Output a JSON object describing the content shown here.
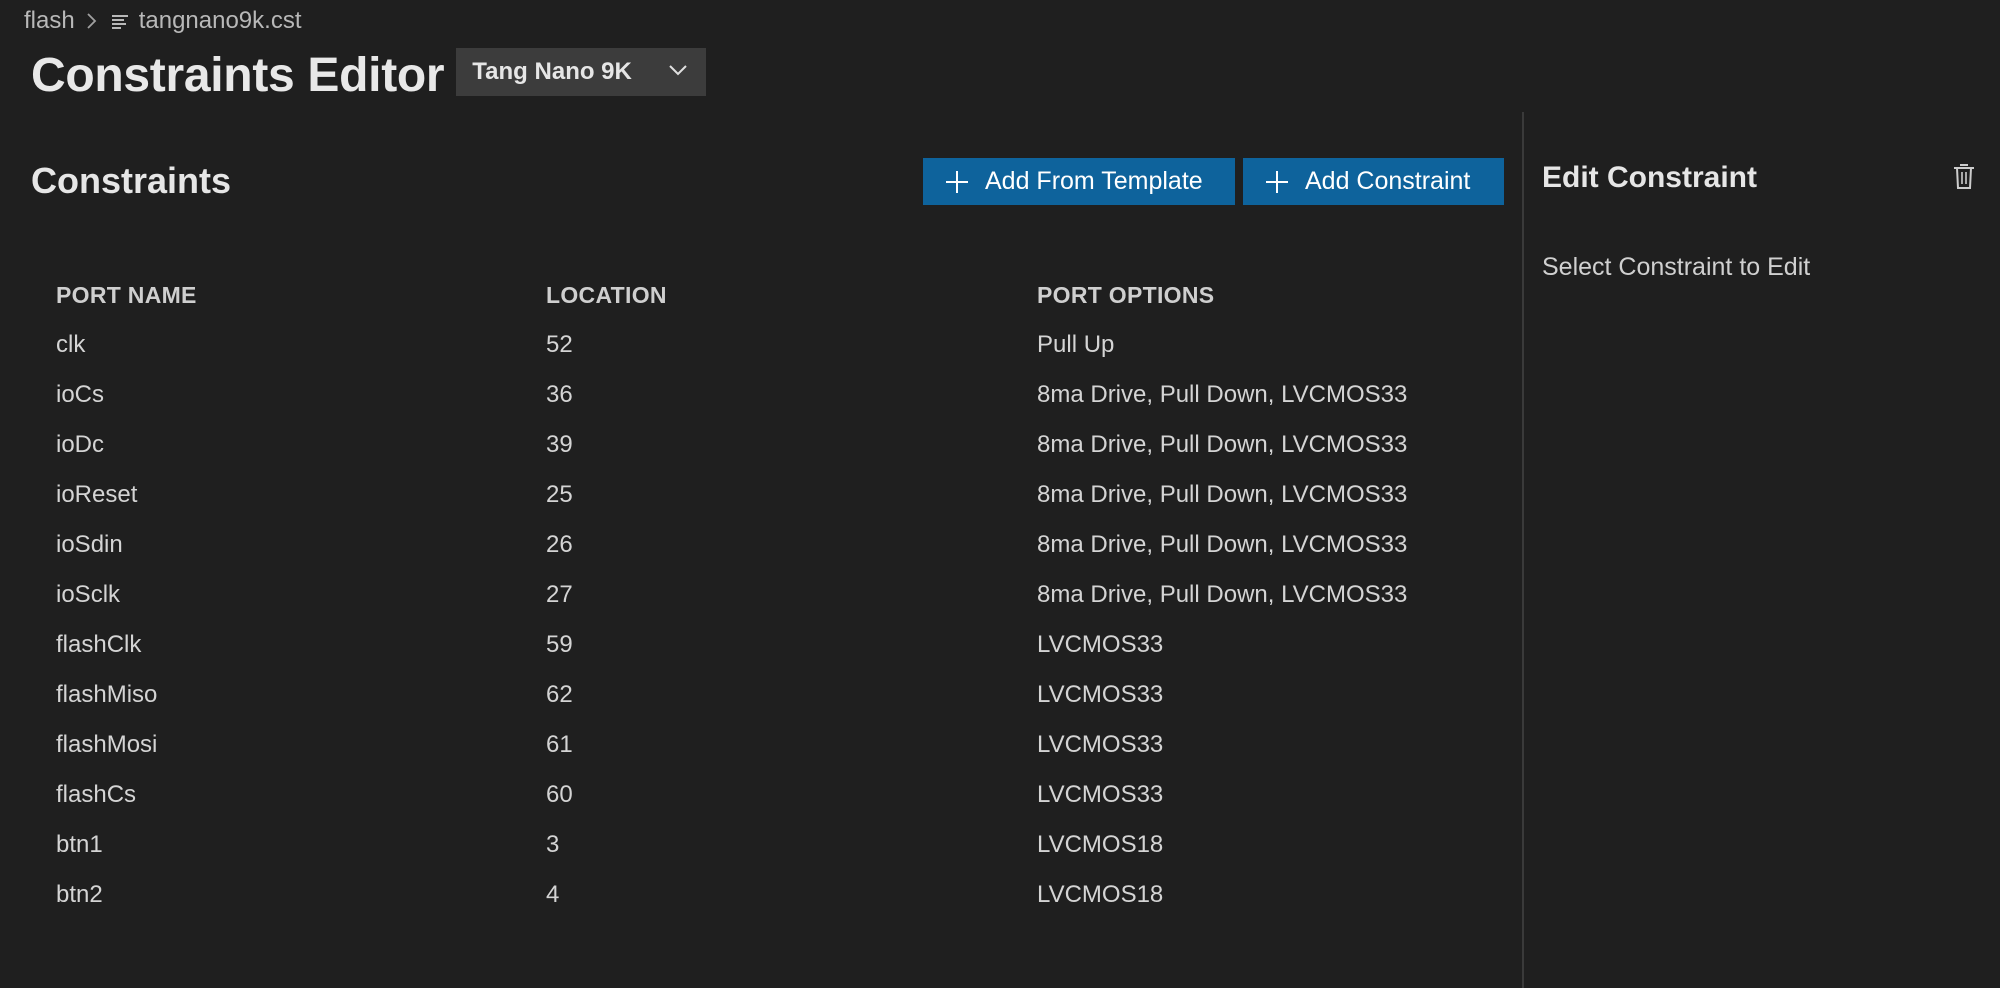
{
  "breadcrumb": {
    "folder": "flash",
    "file": "tangnano9k.cst"
  },
  "header": {
    "title": "Constraints Editor",
    "board_select": "Tang Nano 9K"
  },
  "constraints": {
    "section_title": "Constraints",
    "add_template_label": "Add From Template",
    "add_constraint_label": "Add Constraint",
    "columns": [
      "PORT NAME",
      "LOCATION",
      "PORT OPTIONS"
    ],
    "rows": [
      {
        "port": "clk",
        "location": "52",
        "options": "Pull Up"
      },
      {
        "port": "ioCs",
        "location": "36",
        "options": "8ma Drive, Pull Down, LVCMOS33"
      },
      {
        "port": "ioDc",
        "location": "39",
        "options": "8ma Drive, Pull Down, LVCMOS33"
      },
      {
        "port": "ioReset",
        "location": "25",
        "options": "8ma Drive, Pull Down, LVCMOS33"
      },
      {
        "port": "ioSdin",
        "location": "26",
        "options": "8ma Drive, Pull Down, LVCMOS33"
      },
      {
        "port": "ioSclk",
        "location": "27",
        "options": "8ma Drive, Pull Down, LVCMOS33"
      },
      {
        "port": "flashClk",
        "location": "59",
        "options": "LVCMOS33"
      },
      {
        "port": "flashMiso",
        "location": "62",
        "options": "LVCMOS33"
      },
      {
        "port": "flashMosi",
        "location": "61",
        "options": "LVCMOS33"
      },
      {
        "port": "flashCs",
        "location": "60",
        "options": "LVCMOS33"
      },
      {
        "port": "btn1",
        "location": "3",
        "options": "LVCMOS18"
      },
      {
        "port": "btn2",
        "location": "4",
        "options": "LVCMOS18"
      }
    ]
  },
  "edit_panel": {
    "title": "Edit Constraint",
    "hint": "Select Constraint to Edit"
  },
  "icons": {
    "breadcrumb_separator": "chevron-right-icon",
    "file": "file-lines-icon",
    "dropdown": "chevron-down-icon",
    "add": "plus-icon",
    "delete": "trash-icon"
  },
  "colors": {
    "background": "#1f1f1f",
    "button": "#0e639c",
    "select": "#3c3c3c",
    "divider": "#3a3a3a"
  }
}
